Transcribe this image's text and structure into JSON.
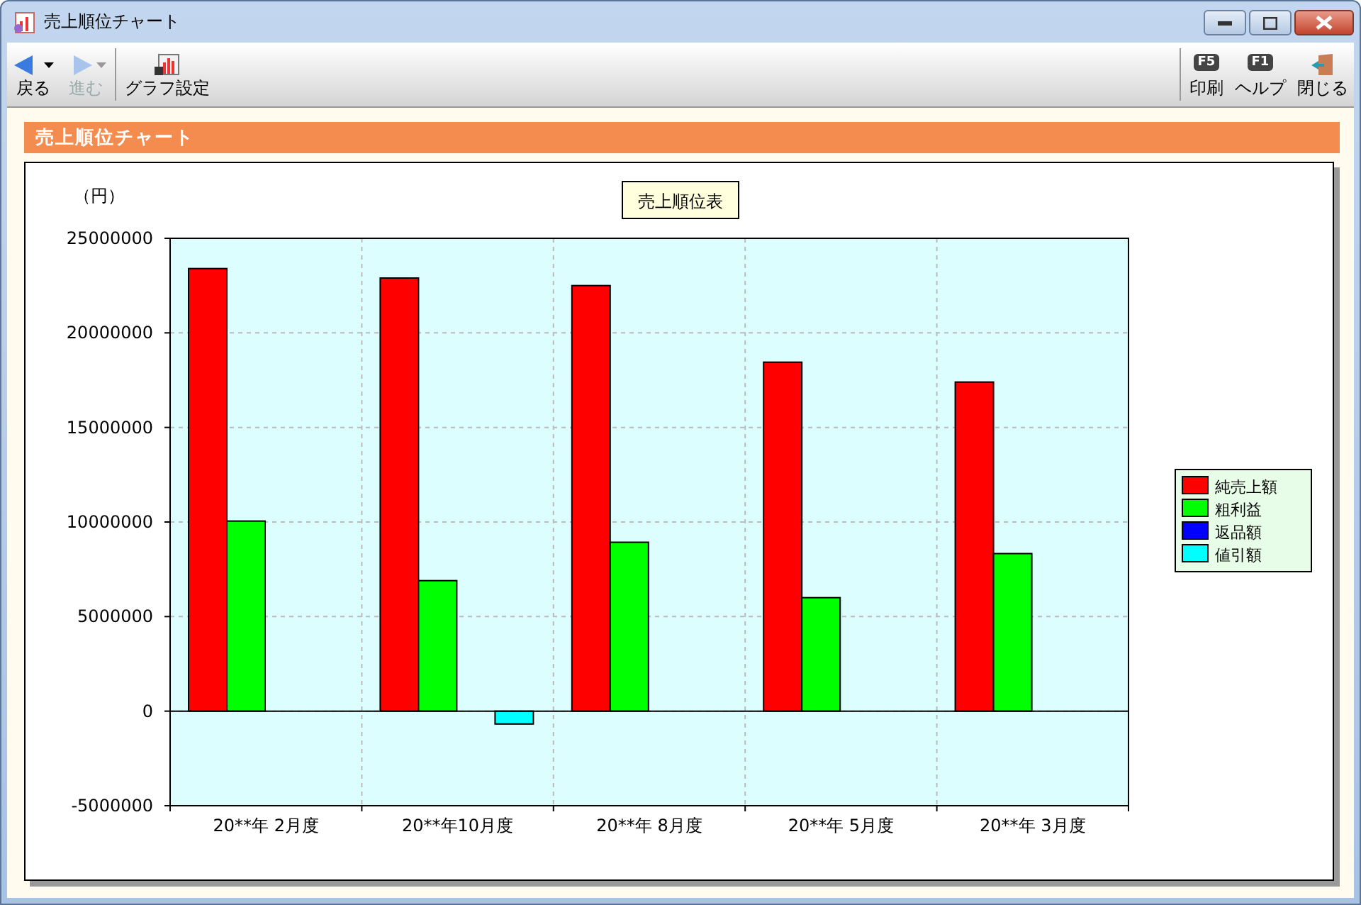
{
  "window": {
    "title": "売上順位チャート"
  },
  "toolbar": {
    "left": [
      {
        "label": "戻る",
        "kind": "back",
        "disabled": false
      },
      {
        "label": "進む",
        "kind": "forward",
        "disabled": true
      },
      {
        "label": "グラフ設定",
        "kind": "chart-settings",
        "disabled": false
      }
    ],
    "right": [
      {
        "label": "印刷",
        "kind": "key",
        "key": "F5"
      },
      {
        "label": "ヘルプ",
        "kind": "key",
        "key": "F1"
      },
      {
        "label": "閉じる",
        "kind": "exit"
      }
    ]
  },
  "header": {
    "title": "売上順位チャート"
  },
  "chart": {
    "chart_data": {
      "type": "bar",
      "title": "売上順位表",
      "ylabel": "（円）",
      "categories": [
        "20**年 2月度",
        "20**年10月度",
        "20**年 8月度",
        "20**年 5月度",
        "20**年 3月度"
      ],
      "series": [
        {
          "name": "純売上額",
          "color": "#ff0000",
          "values": [
            23400000,
            22900000,
            22500000,
            18450000,
            17400000
          ]
        },
        {
          "name": "粗利益",
          "color": "#00ff00",
          "values": [
            10050000,
            6900000,
            8930000,
            6000000,
            8330000
          ]
        },
        {
          "name": "返品額",
          "color": "#0000ff",
          "values": [
            null,
            null,
            null,
            null,
            null
          ]
        },
        {
          "name": "値引額",
          "color": "#00ffff",
          "values": [
            null,
            -680000,
            null,
            null,
            null
          ]
        }
      ],
      "grid": true,
      "legend": true,
      "ylim": [
        -5000000,
        25000000
      ],
      "yticks": [
        -5000000,
        0,
        5000000,
        10000000,
        15000000,
        20000000,
        25000000
      ]
    }
  }
}
